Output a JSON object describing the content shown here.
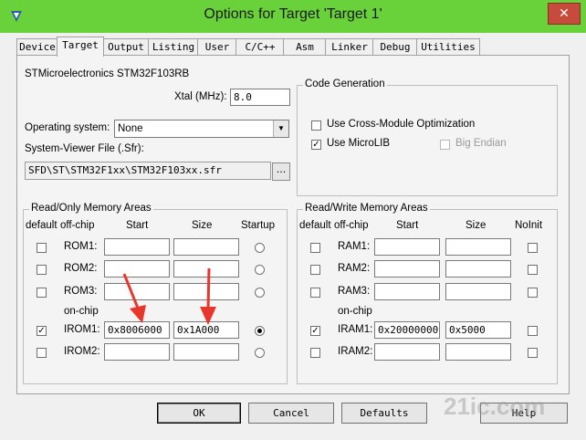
{
  "window": {
    "title": "Options for Target 'Target 1'",
    "close_glyph": "✕"
  },
  "tabs": [
    {
      "label": "Device"
    },
    {
      "label": "Target"
    },
    {
      "label": "Output"
    },
    {
      "label": "Listing"
    },
    {
      "label": "User"
    },
    {
      "label": "C/C++"
    },
    {
      "label": "Asm"
    },
    {
      "label": "Linker"
    },
    {
      "label": "Debug"
    },
    {
      "label": "Utilities"
    }
  ],
  "active_tab": "Target",
  "target": {
    "device_name": "STMicroelectronics STM32F103RB",
    "xtal_label": "Xtal (MHz):",
    "xtal_value": "8.0",
    "os_label": "Operating system:",
    "os_value": "None",
    "sfr_label": "System-Viewer File (.Sfr):",
    "sfr_value": "SFD\\ST\\STM32F1xx\\STM32F103xx.sfr",
    "browse_label": "..."
  },
  "code_generation": {
    "title": "Code Generation",
    "cross_module": {
      "label": "Use Cross-Module Optimization",
      "checked": false
    },
    "microlib": {
      "label": "Use MicroLIB",
      "checked": true
    },
    "big_endian": {
      "label": "Big Endian",
      "checked": false,
      "disabled": true
    }
  },
  "ro_memory": {
    "title": "Read/Only Memory Areas",
    "headers": {
      "default": "default",
      "offchip": "off-chip",
      "start": "Start",
      "size": "Size",
      "startup": "Startup"
    },
    "onchip_label": "on-chip",
    "rows": [
      {
        "name": "ROM1:",
        "default": false,
        "start": "",
        "size": "",
        "startup": false
      },
      {
        "name": "ROM2:",
        "default": false,
        "start": "",
        "size": "",
        "startup": false
      },
      {
        "name": "ROM3:",
        "default": false,
        "start": "",
        "size": "",
        "startup": false
      },
      {
        "name": "IROM1:",
        "default": true,
        "start": "0x8006000",
        "size": "0x1A000",
        "startup": true
      },
      {
        "name": "IROM2:",
        "default": false,
        "start": "",
        "size": "",
        "startup": false
      }
    ]
  },
  "rw_memory": {
    "title": "Read/Write Memory Areas",
    "headers": {
      "default": "default",
      "offchip": "off-chip",
      "start": "Start",
      "size": "Size",
      "noinit": "NoInit"
    },
    "onchip_label": "on-chip",
    "rows": [
      {
        "name": "RAM1:",
        "default": false,
        "start": "",
        "size": "",
        "noinit": false
      },
      {
        "name": "RAM2:",
        "default": false,
        "start": "",
        "size": "",
        "noinit": false
      },
      {
        "name": "RAM3:",
        "default": false,
        "start": "",
        "size": "",
        "noinit": false
      },
      {
        "name": "IRAM1:",
        "default": true,
        "start": "0x20000000",
        "size": "0x5000",
        "noinit": false
      },
      {
        "name": "IRAM2:",
        "default": false,
        "start": "",
        "size": "",
        "noinit": false
      }
    ]
  },
  "buttons": {
    "ok": "OK",
    "cancel": "Cancel",
    "defaults": "Defaults",
    "help": "Help"
  },
  "annotation_color": "#e8362d",
  "watermark": "21ic.com"
}
